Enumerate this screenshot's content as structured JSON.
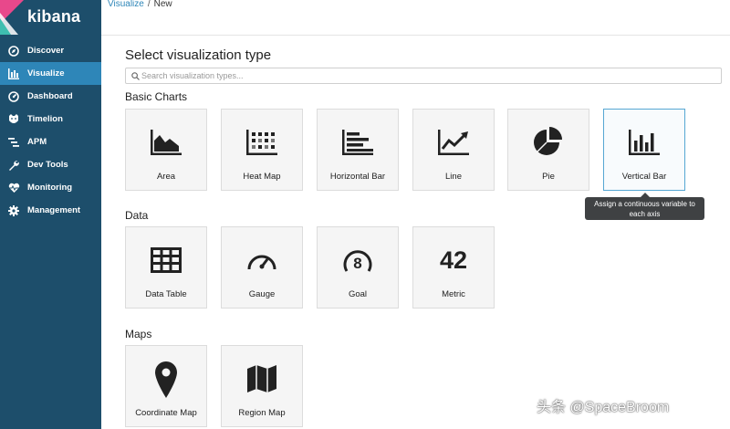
{
  "app": {
    "name": "kibana"
  },
  "nav": {
    "items": [
      {
        "label": "Discover",
        "icon": "compass-icon",
        "active": false
      },
      {
        "label": "Visualize",
        "icon": "bar-chart-icon",
        "active": true
      },
      {
        "label": "Dashboard",
        "icon": "dashboard-icon",
        "active": false
      },
      {
        "label": "Timelion",
        "icon": "timelion-icon",
        "active": false
      },
      {
        "label": "APM",
        "icon": "apm-icon",
        "active": false
      },
      {
        "label": "Dev Tools",
        "icon": "wrench-icon",
        "active": false
      },
      {
        "label": "Monitoring",
        "icon": "heartbeat-icon",
        "active": false
      },
      {
        "label": "Management",
        "icon": "gear-icon",
        "active": false
      }
    ]
  },
  "breadcrumb": {
    "parent": "Visualize",
    "separator": "/",
    "current": "New"
  },
  "page": {
    "title": "Select visualization type",
    "search_placeholder": "Search visualization types...",
    "search_value": ""
  },
  "sections": {
    "basic": {
      "title": "Basic Charts",
      "tiles": [
        {
          "label": "Area",
          "icon": "area-chart-icon"
        },
        {
          "label": "Heat Map",
          "icon": "heat-map-icon"
        },
        {
          "label": "Horizontal Bar",
          "icon": "horizontal-bar-icon"
        },
        {
          "label": "Line",
          "icon": "line-chart-icon"
        },
        {
          "label": "Pie",
          "icon": "pie-chart-icon"
        },
        {
          "label": "Vertical Bar",
          "icon": "vertical-bar-icon"
        }
      ]
    },
    "data": {
      "title": "Data",
      "tiles": [
        {
          "label": "Data Table",
          "icon": "table-icon"
        },
        {
          "label": "Gauge",
          "icon": "gauge-icon"
        },
        {
          "label": "Goal",
          "icon": "goal-icon",
          "glyph": "8"
        },
        {
          "label": "Metric",
          "icon": "metric-icon",
          "glyph": "42"
        }
      ]
    },
    "maps": {
      "title": "Maps",
      "tiles": [
        {
          "label": "Coordinate Map",
          "icon": "map-pin-icon"
        },
        {
          "label": "Region Map",
          "icon": "region-map-icon"
        }
      ]
    }
  },
  "tooltip": {
    "line1": "Assign a continuous variable to",
    "line2": "each axis"
  },
  "watermark": "头条 @SpaceBroom",
  "colors": {
    "sidebar": "#1d4e6b",
    "active": "#2e86b8",
    "tile_bg": "#f5f5f5",
    "tooltip_bg": "#3f4143"
  }
}
